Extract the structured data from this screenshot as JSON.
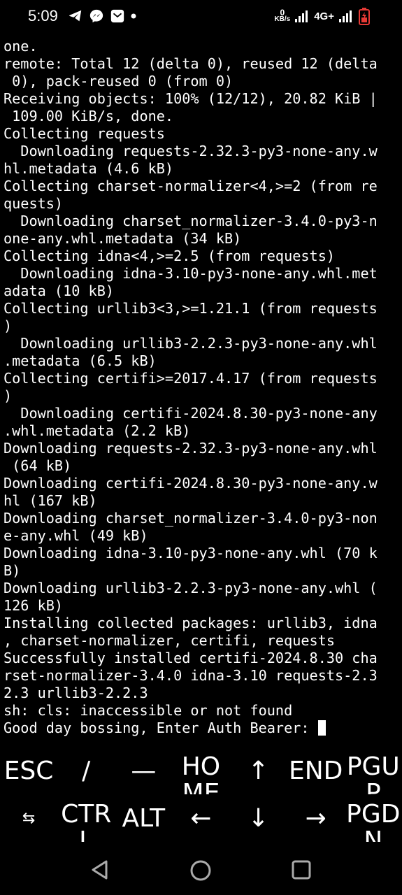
{
  "status_bar": {
    "time": "5:09",
    "left_icons": [
      "telegram-icon",
      "messenger-icon",
      "mail-icon",
      "dot-icon"
    ],
    "net_speed_value": "0",
    "net_speed_unit": "KB/s",
    "network_type": "4G+",
    "right_icons": [
      "signal-icon",
      "signal-icon",
      "battery-charging-icon"
    ],
    "battery_color": "#e53935"
  },
  "terminal": {
    "lines": [
      "one.",
      "remote: Total 12 (delta 0), reused 12 (delta",
      " 0), pack-reused 0 (from 0)",
      "Receiving objects: 100% (12/12), 20.82 KiB |",
      " 109.00 KiB/s, done.",
      "Collecting requests",
      "  Downloading requests-2.32.3-py3-none-any.w",
      "hl.metadata (4.6 kB)",
      "Collecting charset-normalizer<4,>=2 (from re",
      "quests)",
      "  Downloading charset_normalizer-3.4.0-py3-n",
      "one-any.whl.metadata (34 kB)",
      "Collecting idna<4,>=2.5 (from requests)",
      "  Downloading idna-3.10-py3-none-any.whl.met",
      "adata (10 kB)",
      "Collecting urllib3<3,>=1.21.1 (from requests",
      ")",
      "  Downloading urllib3-2.2.3-py3-none-any.whl",
      ".metadata (6.5 kB)",
      "Collecting certifi>=2017.4.17 (from requests",
      ")",
      "  Downloading certifi-2024.8.30-py3-none-any",
      ".whl.metadata (2.2 kB)",
      "Downloading requests-2.32.3-py3-none-any.whl",
      " (64 kB)",
      "Downloading certifi-2024.8.30-py3-none-any.w",
      "hl (167 kB)",
      "Downloading charset_normalizer-3.4.0-py3-non",
      "e-any.whl (49 kB)",
      "Downloading idna-3.10-py3-none-any.whl (70 k",
      "B)",
      "Downloading urllib3-2.2.3-py3-none-any.whl (",
      "126 kB)",
      "Installing collected packages: urllib3, idna",
      ", charset-normalizer, certifi, requests",
      "Successfully installed certifi-2024.8.30 cha",
      "rset-normalizer-3.4.0 idna-3.10 requests-2.3",
      "2.3 urllib3-2.2.3",
      "sh: cls: inaccessible or not found",
      "Good day bossing, Enter Auth Bearer: "
    ]
  },
  "extra_keys": {
    "row1": [
      {
        "label": "ESC",
        "name": "esc-key"
      },
      {
        "label": "/",
        "name": "slash-key"
      },
      {
        "label": "—",
        "name": "dash-key"
      },
      {
        "label": "HOME",
        "name": "home-key"
      },
      {
        "label": "↑",
        "name": "arrow-up-key"
      },
      {
        "label": "END",
        "name": "end-key"
      },
      {
        "label": "PGUP",
        "name": "page-up-key"
      }
    ],
    "row2": [
      {
        "label": "⇆",
        "name": "tab-key"
      },
      {
        "label": "CTRL",
        "name": "ctrl-key"
      },
      {
        "label": "ALT",
        "name": "alt-key"
      },
      {
        "label": "←",
        "name": "arrow-left-key"
      },
      {
        "label": "↓",
        "name": "arrow-down-key"
      },
      {
        "label": "→",
        "name": "arrow-right-key"
      },
      {
        "label": "PGDN",
        "name": "page-down-key"
      }
    ]
  },
  "nav_bar": {
    "icons": [
      "back-triangle-icon",
      "home-circle-icon",
      "recents-square-icon"
    ]
  }
}
